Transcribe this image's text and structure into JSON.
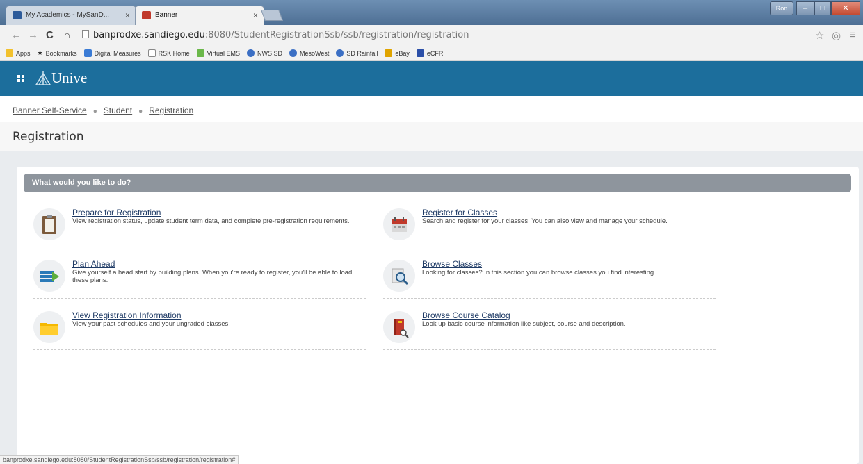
{
  "browser": {
    "tabs": [
      {
        "title": "My Academics - MySanD..."
      },
      {
        "title": "Banner"
      }
    ],
    "window_user": "Ron",
    "address": {
      "prefix": "banprodxe.sandiego.edu",
      "rest": ":8080/StudentRegistrationSsb/ssb/registration/registration"
    },
    "bookmarks": [
      "Apps",
      "Bookmarks",
      "Digital Measures",
      "RSK Home",
      "Virtual EMS",
      "NWS SD",
      "MesoWest",
      "SD Rainfall",
      "eBay",
      "eCFR"
    ],
    "status_url": "banprodxe.sandiego.edu:8080/StudentRegistrationSsb/ssb/registration/registration#"
  },
  "header": {
    "logo_text": "Unive",
    "brand_color": "#1c6e9c"
  },
  "breadcrumbs": [
    "Banner Self-Service",
    "Student",
    "Registration"
  ],
  "page_title": "Registration",
  "panel": {
    "heading": "What would you like to do?",
    "actions": [
      {
        "title": "Prepare for Registration",
        "icon": "clipboard-icon",
        "desc": "View registration status, update student term data, and complete pre-registration requirements."
      },
      {
        "title": "Register for Classes",
        "icon": "calendar-icon",
        "desc": "Search and register for your classes. You can also view and manage your schedule."
      },
      {
        "title": "Plan Ahead",
        "icon": "plan-list-icon",
        "desc": "Give yourself a head start by building plans. When you're ready to register, you'll be able to load these plans."
      },
      {
        "title": "Browse Classes",
        "icon": "magnifier-icon",
        "desc": "Looking for classes? In this section you can browse classes you find interesting."
      },
      {
        "title": "View Registration Information",
        "icon": "folder-icon",
        "desc": "View your past schedules and your ungraded classes."
      },
      {
        "title": "Browse Course Catalog",
        "icon": "book-icon",
        "desc": "Look up basic course information like subject, course and description."
      }
    ]
  }
}
